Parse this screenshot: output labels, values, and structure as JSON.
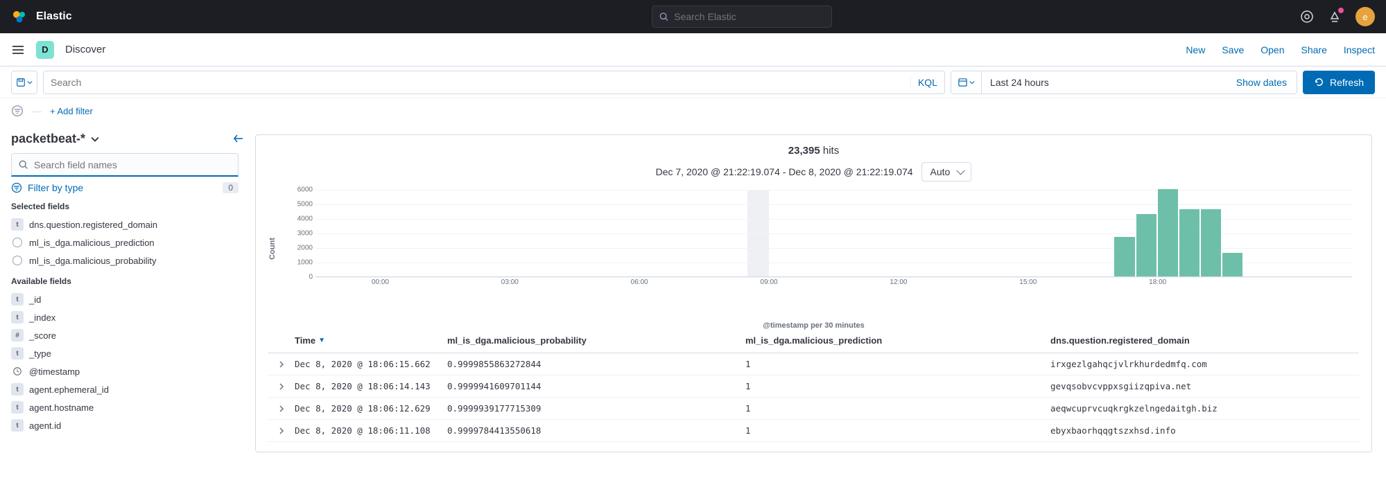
{
  "header": {
    "brand": "Elastic",
    "search_placeholder": "Search Elastic",
    "avatar_initial": "e"
  },
  "appbar": {
    "space_initial": "D",
    "title": "Discover",
    "links": [
      "New",
      "Save",
      "Open",
      "Share",
      "Inspect"
    ]
  },
  "querybar": {
    "search_placeholder": "Search",
    "lang": "KQL",
    "date_range": "Last 24 hours",
    "show_dates": "Show dates",
    "refresh": "Refresh"
  },
  "filterbar": {
    "add_filter": "+ Add filter"
  },
  "sidebar": {
    "index_pattern": "packetbeat-*",
    "field_search_placeholder": "Search field names",
    "filter_by_type": "Filter by type",
    "filter_count": "0",
    "selected_title": "Selected fields",
    "available_title": "Available fields",
    "selected_fields": [
      {
        "type": "t",
        "name": "dns.question.registered_domain"
      },
      {
        "type": "dot",
        "name": "ml_is_dga.malicious_prediction"
      },
      {
        "type": "dot",
        "name": "ml_is_dga.malicious_probability"
      }
    ],
    "available_fields": [
      {
        "type": "t",
        "name": "_id"
      },
      {
        "type": "t",
        "name": "_index"
      },
      {
        "type": "num",
        "name": "_score"
      },
      {
        "type": "t",
        "name": "_type"
      },
      {
        "type": "clock",
        "name": "@timestamp"
      },
      {
        "type": "t",
        "name": "agent.ephemeral_id"
      },
      {
        "type": "t",
        "name": "agent.hostname"
      },
      {
        "type": "t",
        "name": "agent.id"
      }
    ]
  },
  "results": {
    "hits_number": "23,395",
    "hits_label": "hits",
    "time_range": "Dec 7, 2020 @ 21:22:19.074 - Dec 8, 2020 @ 21:22:19.074",
    "interval_select": "Auto",
    "x_axis_label": "@timestamp per 30 minutes",
    "y_axis_label": "Count"
  },
  "chart_data": {
    "type": "bar",
    "ylabel": "Count",
    "xlabel": "@timestamp per 30 minutes",
    "ylim": [
      0,
      6000
    ],
    "y_ticks": [
      0,
      1000,
      2000,
      3000,
      4000,
      5000,
      6000
    ],
    "x_ticks": [
      "00:00",
      "03:00",
      "06:00",
      "09:00",
      "12:00",
      "15:00",
      "18:00"
    ],
    "categories_per_tick": 6,
    "series": [
      {
        "name": "doc count",
        "color": "#6dbfa9",
        "bars": [
          {
            "index": 37,
            "value": 2700
          },
          {
            "index": 38,
            "value": 4300
          },
          {
            "index": 39,
            "value": 6000
          },
          {
            "index": 40,
            "value": 4600
          },
          {
            "index": 41,
            "value": 4600
          },
          {
            "index": 42,
            "value": 1600
          }
        ]
      }
    ],
    "highlight_index": 20
  },
  "table": {
    "columns": {
      "time": "Time",
      "prob": "ml_is_dga.malicious_probability",
      "pred": "ml_is_dga.malicious_prediction",
      "dom": "dns.question.registered_domain"
    },
    "rows": [
      {
        "time": "Dec 8, 2020 @ 18:06:15.662",
        "prob": "0.9999855863272844",
        "pred": "1",
        "dom": "irxgezlgahqcjvlrkhurdedmfq.com"
      },
      {
        "time": "Dec 8, 2020 @ 18:06:14.143",
        "prob": "0.9999941609701144",
        "pred": "1",
        "dom": "gevqsobvcvppxsgiizqpiva.net"
      },
      {
        "time": "Dec 8, 2020 @ 18:06:12.629",
        "prob": "0.9999939177715309",
        "pred": "1",
        "dom": "aeqwcuprvcuqkrgkzelngedaitgh.biz"
      },
      {
        "time": "Dec 8, 2020 @ 18:06:11.108",
        "prob": "0.9999784413550618",
        "pred": "1",
        "dom": "ebyxbaorhqqgtszxhsd.info"
      }
    ]
  }
}
